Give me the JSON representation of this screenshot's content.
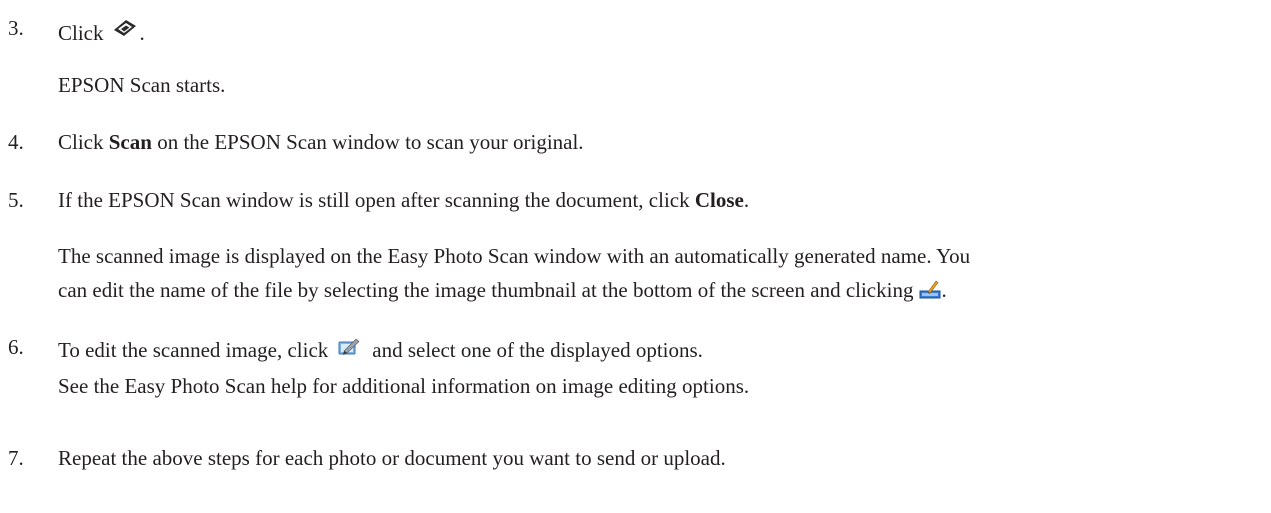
{
  "steps": [
    {
      "number": "3.",
      "line1_before": "Click",
      "line1_icon": "scanner-icon",
      "line1_after": ".",
      "line2": "EPSON Scan starts."
    },
    {
      "number": "4.",
      "before": "Click ",
      "bold": "Scan",
      "after": " on the EPSON Scan window to scan your original."
    },
    {
      "number": "5.",
      "before": "If the EPSON Scan window is still open after scanning the document, click ",
      "bold": "Close",
      "after": ".",
      "para_line1": "The scanned image is displayed on the Easy Photo Scan window with an automatically generated name. You",
      "para_line2_before": "can edit the name of the file by selecting the image thumbnail at the bottom of the screen and clicking",
      "para_line2_icon": "rename-icon",
      "para_line2_after": "."
    },
    {
      "number": "6.",
      "before": "To edit the scanned image, click",
      "icon": "edit-image-icon",
      "after": "and select one of the displayed options.",
      "line2": "See the Easy Photo Scan help for additional information on image editing options."
    },
    {
      "number": "7.",
      "text": "Repeat the above steps for each photo or document you want to send or upload."
    }
  ]
}
